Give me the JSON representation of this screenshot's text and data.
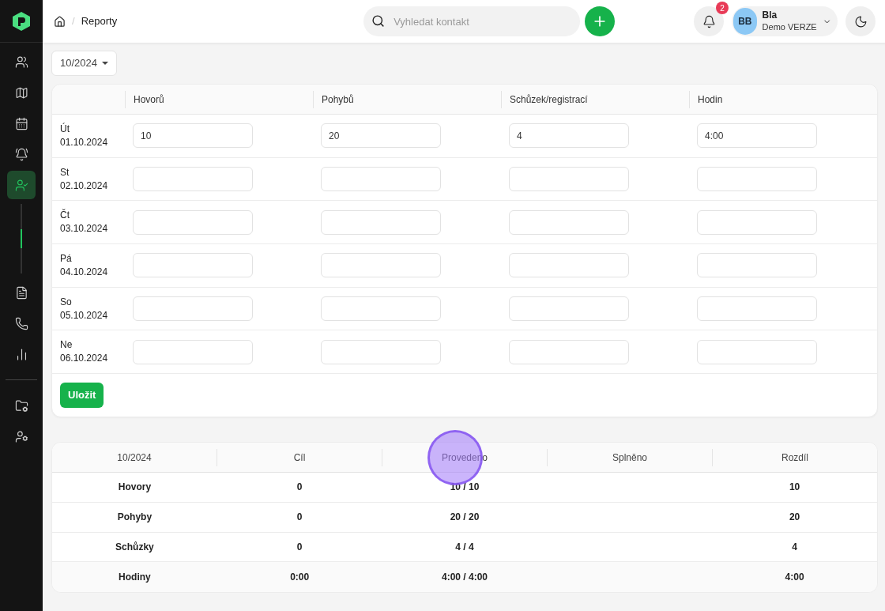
{
  "sidebar": {
    "groups": [
      [
        {
          "kind": "users",
          "selected": false
        },
        {
          "kind": "map",
          "selected": false
        },
        {
          "kind": "calendar",
          "selected": false
        },
        {
          "kind": "alarm",
          "selected": false
        },
        {
          "kind": "user-key",
          "selected": true
        }
      ],
      [
        {
          "kind": "document",
          "selected": false
        },
        {
          "kind": "phone",
          "selected": false
        },
        {
          "kind": "chart",
          "selected": false
        }
      ],
      [
        {
          "kind": "folder-settings",
          "selected": false
        },
        {
          "kind": "user-settings",
          "selected": false
        }
      ]
    ]
  },
  "breadcrumb": {
    "separator": "/",
    "current": "Reporty"
  },
  "search": {
    "placeholder": "Vyhledat kontakt"
  },
  "notifications": {
    "count": "2"
  },
  "user": {
    "initials": "BB",
    "name": "Bla",
    "org": "Demo VERZE"
  },
  "month_select": {
    "value": "10/2024"
  },
  "entry_table": {
    "columns": [
      "Hovorů",
      "Pohybů",
      "Schůzek/registrací",
      "Hodin"
    ],
    "rows": [
      {
        "day": "Út",
        "date": "01.10.2024",
        "values": [
          "10",
          "20",
          "4",
          "4:00"
        ]
      },
      {
        "day": "St",
        "date": "02.10.2024"
      },
      {
        "day": "Čt",
        "date": "03.10.2024"
      },
      {
        "day": "Pá",
        "date": "04.10.2024"
      },
      {
        "day": "So",
        "date": "05.10.2024"
      },
      {
        "day": "Ne",
        "date": "06.10.2024"
      }
    ],
    "save_button": "Uložit"
  },
  "summary_table": {
    "columns": [
      "10/2024",
      "Cíl",
      "Provedeno",
      "Splněno",
      "Rozdíl"
    ],
    "rows": [
      {
        "label": "Hovory",
        "goal": "0",
        "done": "10 / 10",
        "difference": "10"
      },
      {
        "label": "Pohyby",
        "goal": "0",
        "done": "20 / 20",
        "difference": "20"
      },
      {
        "label": "Schůzky",
        "goal": "0",
        "done": "4 / 4",
        "difference": "4"
      },
      {
        "label": "Hodiny",
        "goal": "0:00",
        "done": "4:00 / 4:00",
        "difference": "4:00"
      }
    ]
  }
}
